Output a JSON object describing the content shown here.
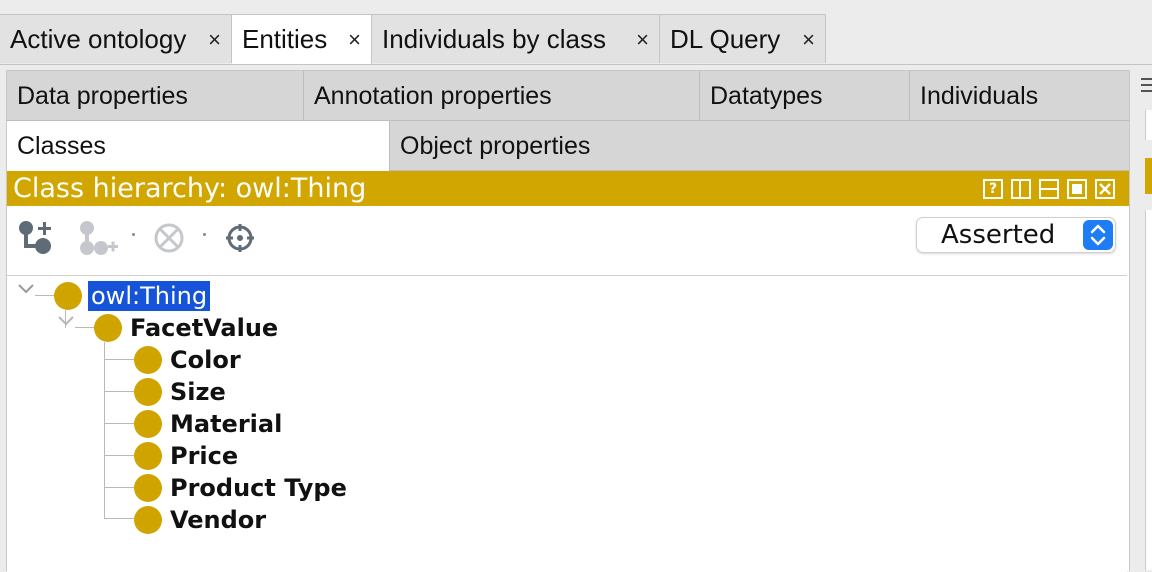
{
  "top_tabs": [
    {
      "label": "Active ontology",
      "close": "×"
    },
    {
      "label": "Entities",
      "close": "×"
    },
    {
      "label": "Individuals by class",
      "close": "×"
    },
    {
      "label": "DL Query",
      "close": "×"
    }
  ],
  "entity_tabs": {
    "row1": [
      "Data properties",
      "Annotation properties",
      "Datatypes",
      "Individuals"
    ],
    "row2": [
      "Classes",
      "Object properties"
    ]
  },
  "view": {
    "title": "Class hierarchy: owl:Thing",
    "header_buttons": [
      "?",
      "split-icon",
      "minimize-icon",
      "maximize-icon",
      "close-icon"
    ],
    "mode_select": "Asserted"
  },
  "tree": {
    "root": "owl:Thing",
    "child": "FacetValue",
    "leaves": [
      "Color",
      "Size",
      "Material",
      "Price",
      "Product Type",
      "Vendor"
    ]
  },
  "colors": {
    "accent": "#d1a600",
    "class_bullet": "#cfa300",
    "selection": "#1553d8",
    "select_arrow": "#1e7cf5"
  }
}
